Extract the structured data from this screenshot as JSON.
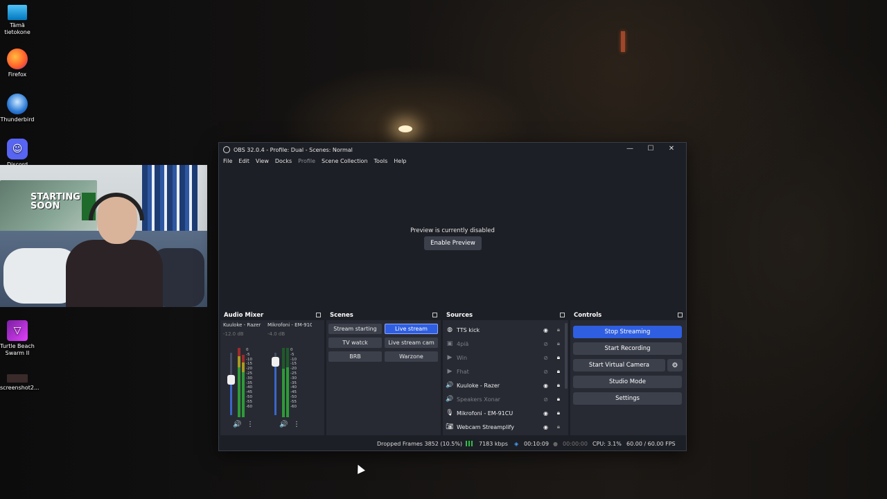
{
  "desktop": {
    "icons": [
      {
        "label": "Tämä tietokone",
        "icon": "monitor-icon"
      },
      {
        "label": "Firefox",
        "icon": "firefox-icon"
      },
      {
        "label": "Thunderbird",
        "icon": "thunderbird-icon"
      },
      {
        "label": "Discord",
        "icon": "discord-icon"
      },
      {
        "label": "Turtle Beach Swarm II",
        "icon": "turtle-beach-icon"
      },
      {
        "label": "screenshot2...",
        "icon": "screenshot-file-icon"
      }
    ]
  },
  "webcam": {
    "poster_text": "STARTING SOON"
  },
  "obs": {
    "title": "OBS 32.0.4 - Profile: Dual - Scenes: Normal",
    "menu": [
      "File",
      "Edit",
      "View",
      "Docks",
      "Profile",
      "Scene Collection",
      "Tools",
      "Help"
    ],
    "preview": {
      "message": "Preview is currently disabled",
      "button": "Enable Preview"
    },
    "audio_mixer": {
      "title": "Audio Mixer",
      "channels": [
        {
          "name": "Kuuloke - Razer",
          "db": "-12.0 dB"
        },
        {
          "name": "Mikrofoni - EM-91C",
          "db": "-4.0 dB"
        }
      ],
      "scale": [
        "0",
        "-5",
        "-10",
        "-15",
        "-20",
        "-25",
        "-30",
        "-35",
        "-40",
        "-45",
        "-50",
        "-55",
        "-60"
      ]
    },
    "scenes": {
      "title": "Scenes",
      "items": [
        "Stream starting",
        "Live stream",
        "TV watck",
        "Live stream cam",
        "BRB",
        "Warzone"
      ],
      "selected": "Live stream"
    },
    "sources": {
      "title": "Sources",
      "items": [
        {
          "name": "TTS kick",
          "icon": "globe-icon",
          "visible": true
        },
        {
          "name": "4piä",
          "icon": "image-icon",
          "visible": false
        },
        {
          "name": "Win",
          "icon": "media-icon",
          "visible": false
        },
        {
          "name": "Fhat",
          "icon": "media-icon",
          "visible": false
        },
        {
          "name": "Kuuloke - Razer",
          "icon": "speaker-icon",
          "visible": true
        },
        {
          "name": "Speakers Xonar",
          "icon": "speaker-icon",
          "visible": false
        },
        {
          "name": "Mikrofoni - EM-91CU",
          "icon": "microphone-icon",
          "visible": true
        },
        {
          "name": "Webcam Streamplify",
          "icon": "camera-icon",
          "visible": true
        }
      ]
    },
    "controls": {
      "title": "Controls",
      "stop_streaming": "Stop Streaming",
      "start_recording": "Start Recording",
      "start_virtual_camera": "Start Virtual Camera",
      "studio_mode": "Studio Mode",
      "settings": "Settings"
    },
    "status": {
      "dropped_frames": "Dropped Frames 3852 (10.5%)",
      "bitrate": "7183 kbps",
      "stream_time": "00:10:09",
      "record_time": "00:00:00",
      "cpu": "CPU: 3.1%",
      "fps": "60.00 / 60.00 FPS"
    }
  }
}
